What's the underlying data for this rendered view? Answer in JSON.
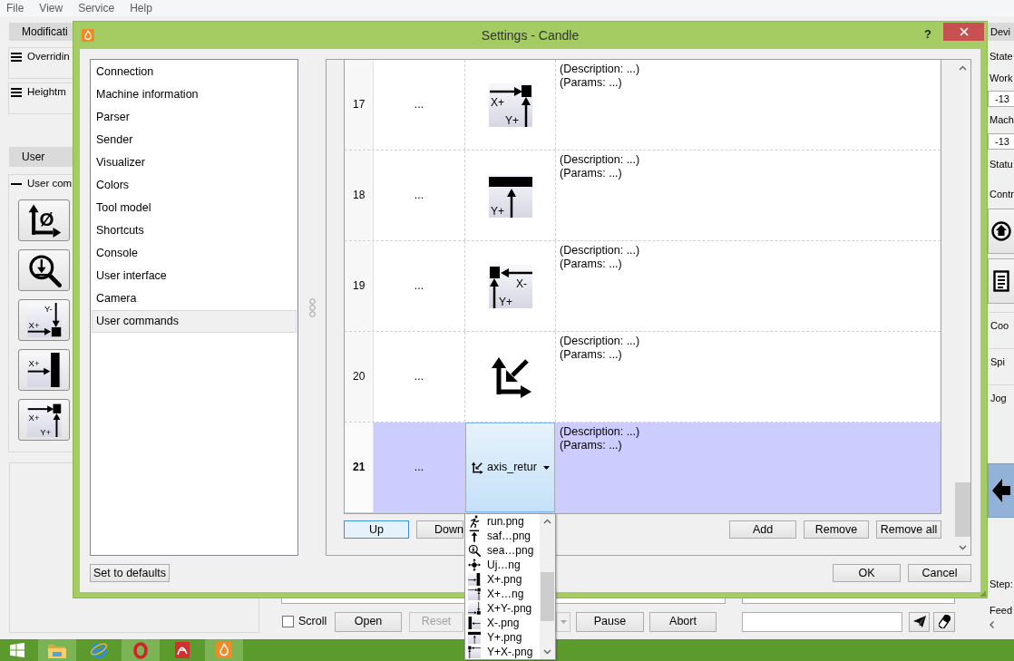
{
  "menu_bar": [
    {
      "label": "File"
    },
    {
      "label": "View"
    },
    {
      "label": "Service"
    },
    {
      "label": "Help"
    }
  ],
  "left_panel": {
    "sections": [
      {
        "header": "Modificati",
        "groups": [
          {
            "title": "Overridin",
            "expanded": false
          },
          {
            "title": "Heightm",
            "expanded": false
          }
        ]
      },
      {
        "header": "User",
        "groups": [
          {
            "title": "User com",
            "expanded": true,
            "buttons": [
              {
                "kind": "zero",
                "labels": [
                  "Ø"
                ]
              },
              {
                "kind": "probe"
              },
              {
                "kind": "ydownxplus",
                "labels": [
                  "Y-",
                  "X+"
                ]
              },
              {
                "kind": "xwall",
                "labels": [
                  "X+"
                ]
              },
              {
                "kind": "cornerxy",
                "labels": [
                  "X+",
                  "Y+"
                ]
              }
            ]
          }
        ]
      }
    ]
  },
  "right_panel": {
    "header": "Devi",
    "items": [
      {
        "kind": "label",
        "text": "State"
      },
      {
        "kind": "label",
        "text": "Work"
      },
      {
        "kind": "field",
        "value": "-13"
      },
      {
        "kind": "label",
        "text": "Mach"
      },
      {
        "kind": "field",
        "value": "-13"
      },
      {
        "kind": "label",
        "text": "Statu"
      },
      {
        "kind": "label",
        "text": "Contr"
      },
      {
        "kind": "home"
      },
      {
        "kind": "document"
      },
      {
        "kind": "group",
        "text": "Coo"
      },
      {
        "kind": "group",
        "text": "Spi"
      },
      {
        "kind": "group",
        "text": "Jog"
      },
      {
        "kind": "jog"
      },
      {
        "kind": "label",
        "text": "Step:"
      },
      {
        "kind": "label",
        "text": "Feed"
      }
    ]
  },
  "bottom_bar": {
    "scroll": {
      "label": "Scroll",
      "checked": false
    },
    "buttons": {
      "open": {
        "label": "Open",
        "disabled": false
      },
      "reset": {
        "label": "Reset",
        "disabled": true
      },
      "menu": {
        "disabled": true
      },
      "pause": {
        "label": "Pause",
        "disabled": false
      },
      "abort": {
        "label": "Abort",
        "disabled": false
      }
    }
  },
  "taskbar": {
    "apps": [
      {
        "kind": "folder",
        "running": true
      },
      {
        "kind": "globe",
        "running": false
      },
      {
        "kind": "ring",
        "running": true
      },
      {
        "kind": "page",
        "running": false
      },
      {
        "kind": "flame",
        "running": true
      }
    ]
  },
  "dialog": {
    "title": "Settings - Candle",
    "help": "?",
    "categories": [
      {
        "label": "Connection",
        "selected": false
      },
      {
        "label": "Machine information",
        "selected": false
      },
      {
        "label": "Parser",
        "selected": false
      },
      {
        "label": "Sender",
        "selected": false
      },
      {
        "label": "Visualizer",
        "selected": false
      },
      {
        "label": "Colors",
        "selected": false
      },
      {
        "label": "Tool model",
        "selected": false
      },
      {
        "label": "Shortcuts",
        "selected": false
      },
      {
        "label": "Console",
        "selected": false
      },
      {
        "label": "User interface",
        "selected": false
      },
      {
        "label": "Camera",
        "selected": false
      },
      {
        "label": "User commands",
        "selected": true
      }
    ],
    "table": {
      "rows": [
        {
          "number": "17",
          "name": "...",
          "icon": {
            "kind": "cornerxy",
            "labels": [
              "X+",
              "Y+"
            ]
          },
          "description": "(Description: ...)",
          "params": "(Params: ...)",
          "selected": false
        },
        {
          "number": "18",
          "name": "...",
          "icon": {
            "kind": "ywall",
            "labels": [
              "Y+"
            ]
          },
          "description": "(Description: ...)",
          "params": "(Params: ...)",
          "selected": false
        },
        {
          "number": "19",
          "name": "...",
          "icon": {
            "kind": "xminusyplus",
            "labels": [
              "X-",
              "Y+"
            ]
          },
          "description": "(Description: ...)",
          "params": "(Params: ...)",
          "selected": false
        },
        {
          "number": "20",
          "name": "...",
          "icon": {
            "kind": "return"
          },
          "description": "(Description: ...)",
          "params": "(Params: ...)",
          "selected": false
        },
        {
          "number": "21",
          "name": "...",
          "editor": {
            "kind": "return",
            "value": "axis_retur",
            "expanded": true,
            "options": [
              {
                "kind": "run",
                "label": "run.png"
              },
              {
                "kind": "safe",
                "label": "saf…png"
              },
              {
                "kind": "probe",
                "label": "sea…png"
              },
              {
                "kind": "move",
                "label": "Uj…ng"
              },
              {
                "kind": "xwall",
                "label": "X+.png"
              },
              {
                "kind": "cornerxy",
                "label": "X+…ng"
              },
              {
                "kind": "ydownxplus",
                "label": "X+Y-.png"
              },
              {
                "kind": "xminus",
                "label": "X-.png"
              },
              {
                "kind": "ywall",
                "label": "Y+.png"
              },
              {
                "kind": "xminusyplus",
                "label": "Y+X-.png"
              }
            ]
          },
          "description": "(Description: ...)",
          "params": "(Params: ...)",
          "selected": true
        }
      ]
    },
    "table_buttons": {
      "up": {
        "label": "Up",
        "focused": true
      },
      "down": {
        "label": "Down",
        "focused": false
      },
      "add": {
        "label": "Add",
        "focused": false
      },
      "remove": {
        "label": "Remove",
        "focused": false
      },
      "remove_all": {
        "label": "Remove all",
        "focused": false
      }
    },
    "footer": {
      "defaults": {
        "label": "Set to defaults"
      },
      "ok": {
        "label": "OK"
      },
      "cancel": {
        "label": "Cancel"
      }
    }
  }
}
